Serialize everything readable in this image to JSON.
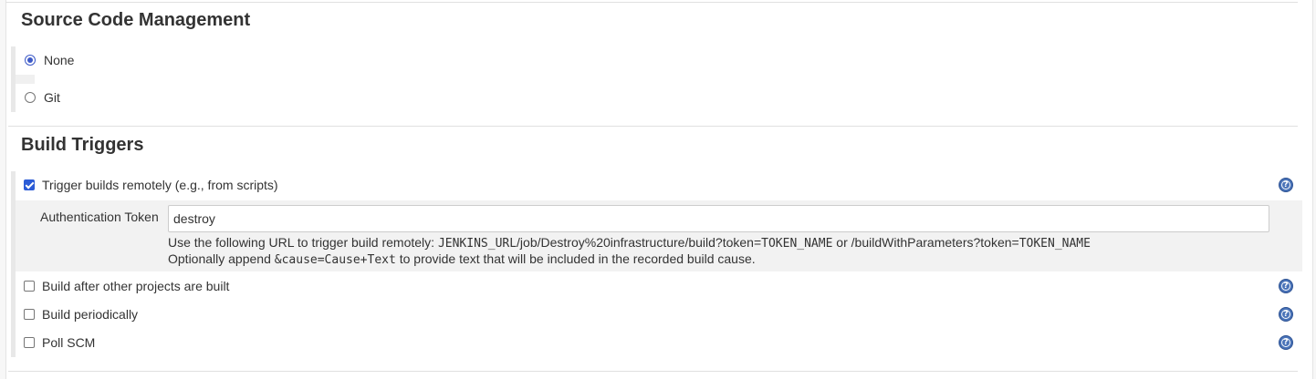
{
  "scm": {
    "title": "Source Code Management",
    "options": [
      {
        "label": "None",
        "selected": true
      },
      {
        "label": "Git",
        "selected": false
      }
    ]
  },
  "triggers": {
    "title": "Build Triggers",
    "remote": {
      "label": "Trigger builds remotely (e.g., from scripts)",
      "checked": true,
      "token_label": "Authentication Token",
      "token_value": "destroy",
      "help_line1": {
        "prefix": "Use the following URL to trigger build remotely: ",
        "url_mono_1": "JENKINS_URL",
        "url_path": "/job/Destroy%20infrastructure/build?token=",
        "url_mono_2": "TOKEN_NAME",
        "middle": " or /buildWithParameters?token=",
        "url_mono_3": "TOKEN_NAME"
      },
      "help_line2": {
        "prefix": "Optionally append ",
        "code": "&cause=Cause+Text",
        "suffix": " to provide text that will be included in the recorded build cause."
      }
    },
    "after_other": {
      "label": "Build after other projects are built",
      "checked": false
    },
    "periodically": {
      "label": "Build periodically",
      "checked": false
    },
    "poll_scm": {
      "label": "Poll SCM",
      "checked": false
    }
  },
  "help_icon_glyph": "?",
  "colors": {
    "accent": "#2b5bd6",
    "help_icon": "#4a73b8",
    "background": "#ffffff",
    "page_background": "#f7f7f7"
  }
}
